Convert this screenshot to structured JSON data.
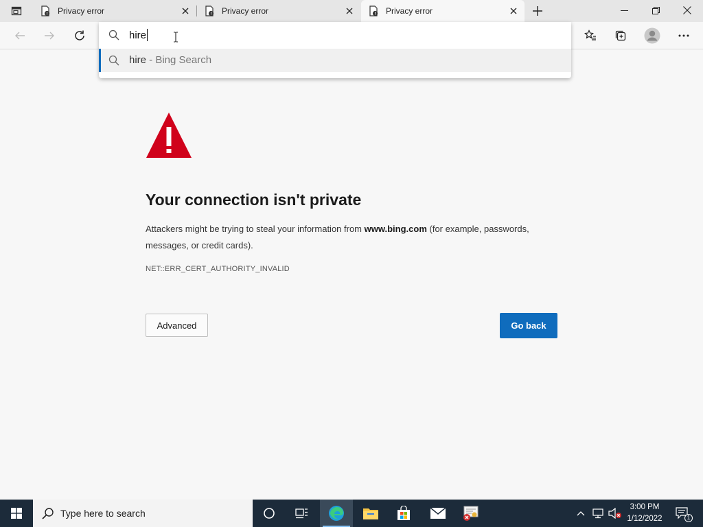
{
  "tabs": [
    {
      "title": "Privacy error"
    },
    {
      "title": "Privacy error"
    },
    {
      "title": "Privacy error"
    }
  ],
  "omnibox": {
    "typed": "hire",
    "suggestion_query": "hire",
    "suggestion_source": " - Bing Search"
  },
  "error_page": {
    "heading": "Your connection isn't private",
    "desc_prefix": "Attackers might be trying to steal your information from ",
    "domain": "www.bing.com",
    "desc_suffix": " (for example, passwords, messages, or credit cards).",
    "error_code": "NET::ERR_CERT_AUTHORITY_INVALID",
    "advanced_label": "Advanced",
    "go_back_label": "Go back"
  },
  "taskbar": {
    "search_placeholder": "Type here to search",
    "time": "3:00 PM",
    "date": "1/12/2022",
    "notification_count": "1"
  },
  "colors": {
    "accent": "#0f6cbd",
    "warning_red": "#d0021b",
    "taskbar": "#1c2b3a"
  }
}
